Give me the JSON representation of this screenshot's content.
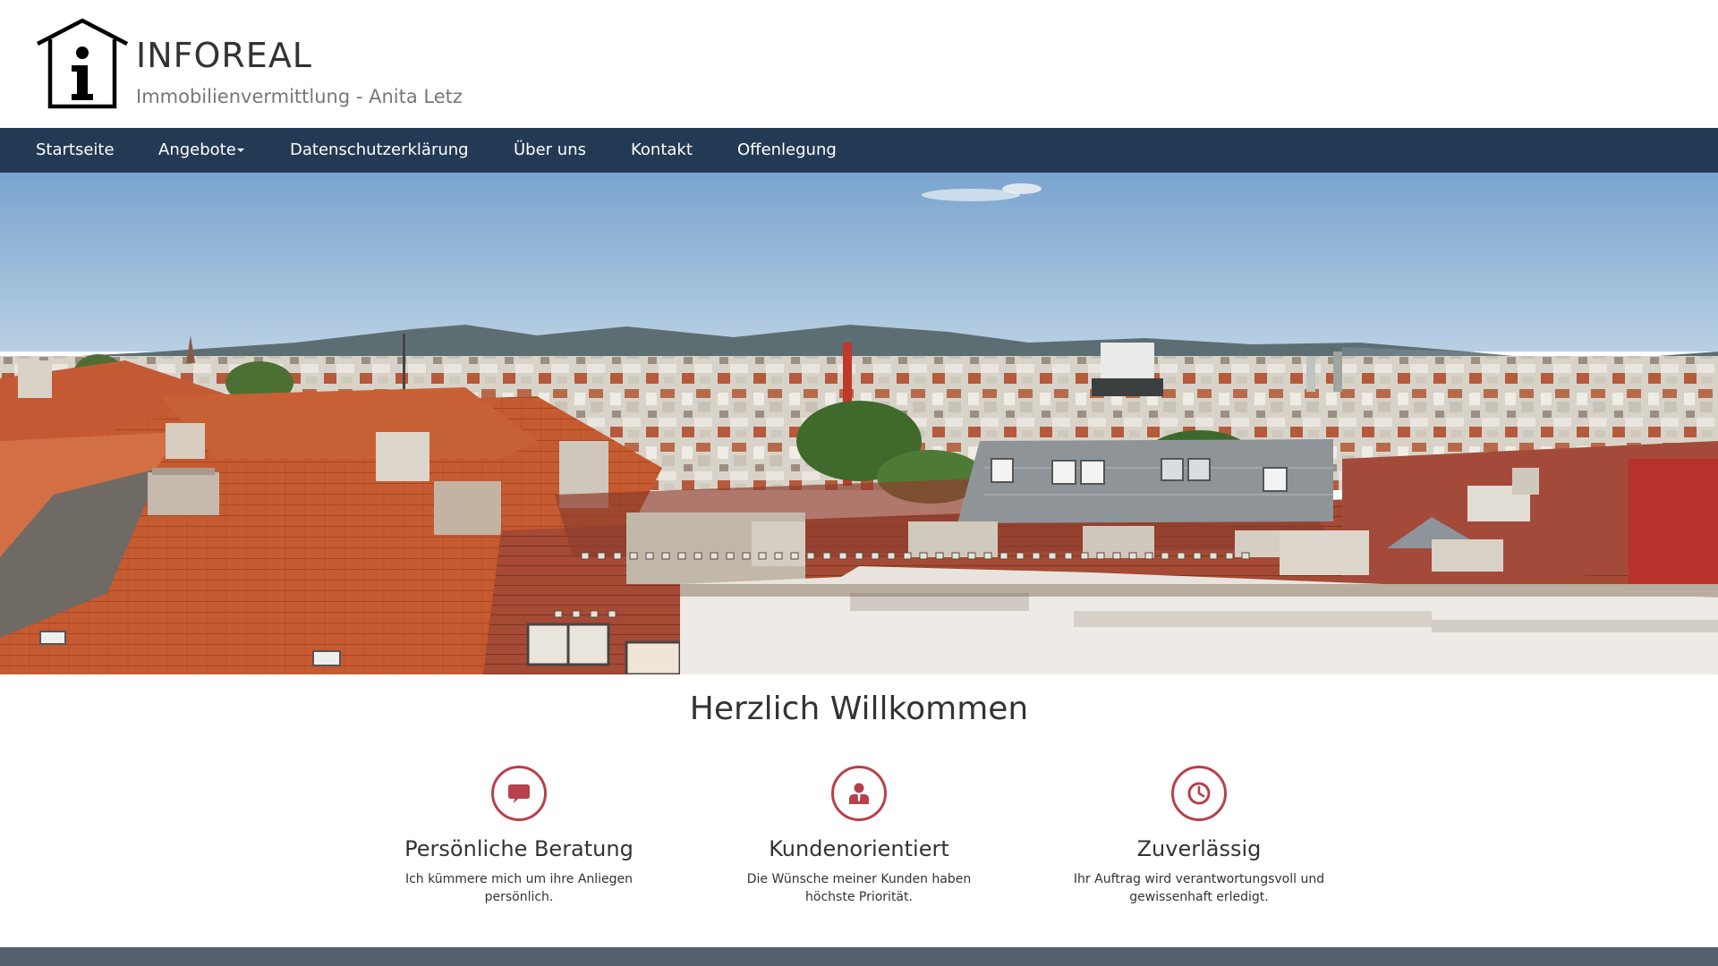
{
  "header": {
    "logo_icon": "house-info-icon",
    "title": "INFOREAL",
    "subtitle": "Immobilienvermittlung - Anita Letz"
  },
  "nav": {
    "items": [
      {
        "label": "Startseite",
        "has_dropdown": false
      },
      {
        "label": "Angebote",
        "has_dropdown": true
      },
      {
        "label": "Datenschutzerklärung",
        "has_dropdown": false
      },
      {
        "label": "Über uns",
        "has_dropdown": false
      },
      {
        "label": "Kontakt",
        "has_dropdown": false
      },
      {
        "label": "Offenlegung",
        "has_dropdown": false
      }
    ]
  },
  "hero": {
    "image": "city-rooftops-panorama"
  },
  "main": {
    "heading": "Herzlich Willkommen",
    "features": [
      {
        "icon": "speech-bubble-icon",
        "title": "Persönliche Beratung",
        "text": "Ich kümmere mich um ihre Anliegen persönlich."
      },
      {
        "icon": "user-icon",
        "title": "Kundenorientiert",
        "text": "Die Wünsche meiner Kunden haben höchste Priorität."
      },
      {
        "icon": "clock-icon",
        "title": "Zuverlässig",
        "text": "Ihr Auftrag wird verantwortungsvoll und gewissenhaft erledigt."
      }
    ]
  },
  "colors": {
    "nav_bg": "#233a54",
    "accent": "#b8404a",
    "footer_bg": "#555f6e"
  }
}
